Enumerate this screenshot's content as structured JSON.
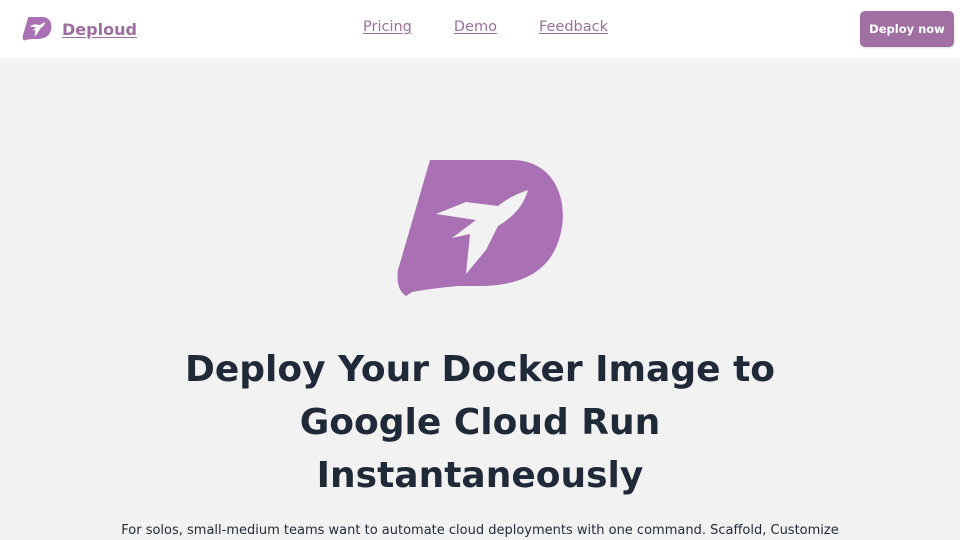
{
  "brand": {
    "name": "Deploud",
    "color": "#9d6d9f",
    "logo_icon": "rocket-d-logo-icon"
  },
  "nav": {
    "links": [
      "Pricing",
      "Demo",
      "Feedback"
    ],
    "cta_label": "Deploy now",
    "cta_color": "#a070a3"
  },
  "hero": {
    "logo_icon": "rocket-d-logo-icon",
    "logo_color": "#a970b3",
    "title_lines": [
      "Deploy Your Docker Image to",
      "Google Cloud Run",
      "Instantaneously"
    ],
    "subtitle": "For solos, small-medium teams want to automate cloud deployments with one command. Scaffold, Customize"
  },
  "colors": {
    "background": "#f2f2f2",
    "navbar": "#ffffff",
    "heading": "#1f2937"
  }
}
